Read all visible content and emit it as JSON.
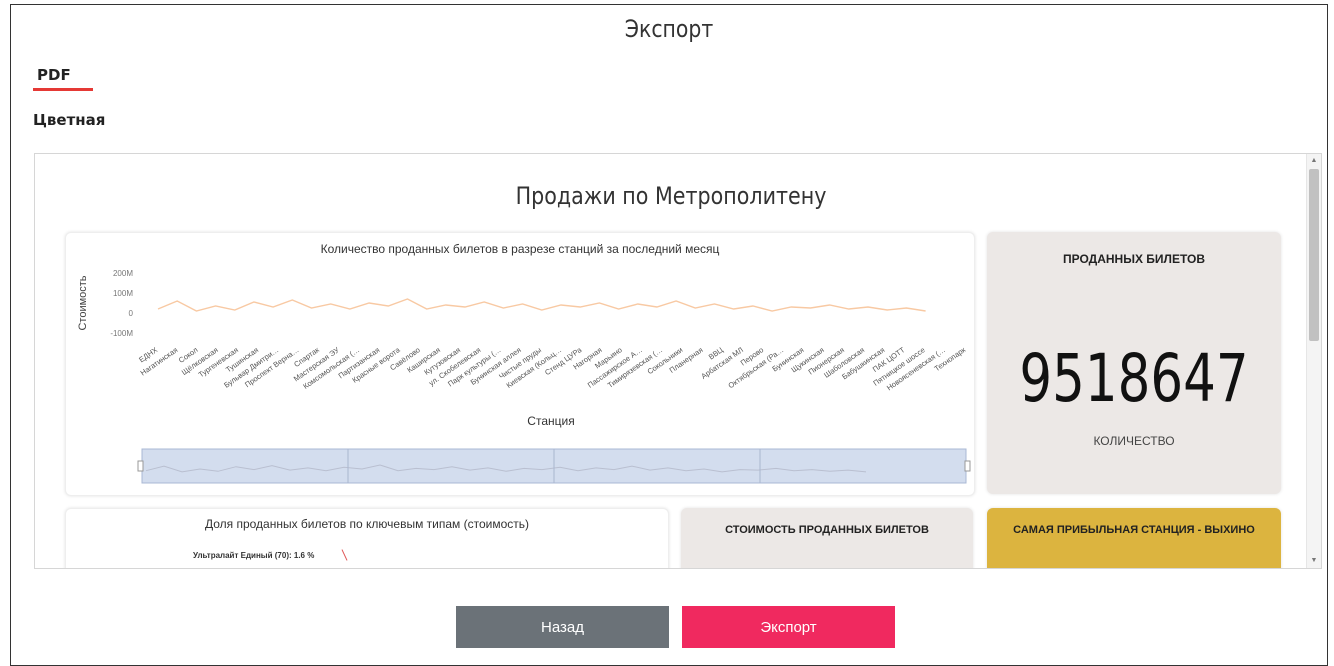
{
  "dialog": {
    "title": "Экспорт",
    "tab": "PDF",
    "subtitle": "Цветная"
  },
  "report": {
    "title": "Продажи по Метрополитену",
    "chart": {
      "title": "Количество проданных билетов в разрезе станций за последний месяц",
      "ylabel": "Стоимость",
      "xlabel": "Станция",
      "yticks": [
        "200M",
        "100M",
        "0",
        "-100M"
      ],
      "line_color": "#f8c9a3"
    },
    "kpi": {
      "label": "ПРОДАННЫХ БИЛЕТОВ",
      "value": "9518647",
      "sublabel": "КОЛИЧЕСТВО"
    },
    "pie": {
      "title": "Доля проданных билетов по ключевым типам (стоимость)",
      "first_label": "Ультралайт Единый (70): 1.6 %"
    },
    "cost_card": {
      "label": "СТОИМОСТЬ ПРОДАННЫХ БИЛЕТОВ"
    },
    "top_station_card": {
      "label": "САМАЯ ПРИБЫЛЬНАЯ СТАНЦИЯ - ВЫХИНО"
    }
  },
  "chart_data": {
    "type": "line",
    "title": "Количество проданных билетов в разрезе станций за последний месяц",
    "xlabel": "Станция",
    "ylabel": "Стоимость",
    "ylim": [
      -100000000,
      200000000
    ],
    "yticks": [
      "200M",
      "100M",
      "0",
      "-100M"
    ],
    "categories": [
      "ЕДНХ",
      "Нагатинская",
      "Сокол",
      "Щёлковская",
      "Тургеневская",
      "Тушинская",
      "Бульвар Дмитри…",
      "Проспект Верна…",
      "Спартак",
      "Мастерская ЭУ",
      "Комсомольская (…",
      "Партизанская",
      "Красные ворота",
      "Савёлово",
      "Каширская",
      "Кутузовская",
      "ул. Скобелевская",
      "Парк культуры (…",
      "Бунинская аллея",
      "Чистые пруды",
      "Киевская (Кольц…",
      "Стенд ЦУРа",
      "Нагорная",
      "Марьино",
      "Пассажирское А…",
      "Тимирязевская (…",
      "Сокольники",
      "Планерная",
      "ВВЦ",
      "Арбатская МЛ",
      "Перово",
      "Октябрьская (Ра…",
      "Бунинская",
      "Щукинская",
      "Пионерская",
      "Шаболовская",
      "Бабушкинская",
      "ПАК ЦОТТ",
      "Пятницкое шоссе",
      "Новоясеневская (…",
      "Технопарк"
    ],
    "series": [
      {
        "values": [
          20,
          60,
          10,
          35,
          15,
          55,
          30,
          65,
          25,
          45,
          20,
          50,
          35,
          70,
          20,
          40,
          30,
          55,
          25,
          45,
          15,
          40,
          30,
          50,
          20,
          45,
          30,
          60,
          25,
          45,
          20,
          35,
          10,
          30,
          25,
          40,
          20,
          30,
          15,
          25,
          10
        ]
      }
    ],
    "series_unit": "M",
    "grid": false,
    "legend": "none"
  },
  "actions": {
    "back": "Назад",
    "export": "Экспорт"
  }
}
